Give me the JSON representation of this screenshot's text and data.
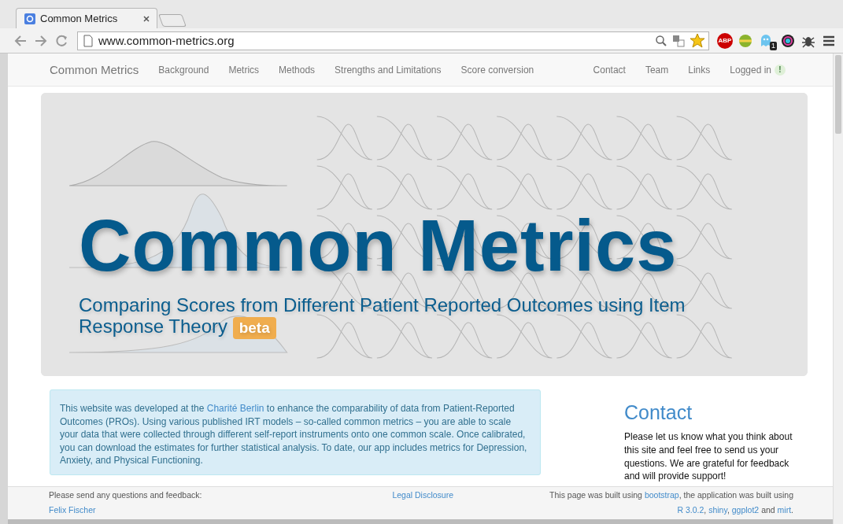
{
  "browser": {
    "tabs": [
      {
        "title": "Common Metrics",
        "selected": true
      }
    ],
    "url": "www.common-metrics.org",
    "extensions": [
      {
        "kind": "abp",
        "label": "ABP"
      },
      {
        "kind": "ball"
      },
      {
        "kind": "ghost",
        "badge": "1"
      },
      {
        "kind": "wheel"
      },
      {
        "kind": "bug"
      }
    ]
  },
  "nav": {
    "brand": "Common Metrics",
    "left": [
      {
        "label": "Background"
      },
      {
        "label": "Metrics"
      },
      {
        "label": "Methods"
      },
      {
        "label": "Strengths and Limitations"
      },
      {
        "label": "Score conversion"
      }
    ],
    "right": [
      {
        "label": "Contact"
      },
      {
        "label": "Team"
      },
      {
        "label": "Links"
      }
    ],
    "login": {
      "label": "Logged in",
      "badge": "!"
    }
  },
  "hero": {
    "kind": "picture",
    "title": "Common Metrics",
    "subtitle": "Comparing Scores from Different Patient Reported Outcomes using Item Response Theory",
    "badge": "beta"
  },
  "intro": {
    "before": "This website was developed at the ",
    "link": "Charité Berlin",
    "after": " to enhance the comparability of data from Patient-Reported Outcomes (PROs). Using various published IRT models – so-called common metrics – you are able to scale your data that were collected through different self-report instruments onto one common scale. Once calibrated, you can download the estimates for further statistical analysis. To date, our app includes metrics for Depression, Anxiety, and Physical Functioning."
  },
  "contact": {
    "heading": "Contact",
    "text": "Please let us know what you think about this site and feel free to send us your questions. We are grateful for feedback and will provide support!"
  },
  "footer": {
    "left": {
      "text": "Please send any questions and feedback:",
      "link": "Felix Fischer"
    },
    "center": {
      "link": "Legal Disclosure"
    },
    "right": [
      [
        {
          "kind": "text",
          "text": "This page was built using "
        },
        {
          "kind": "link",
          "text": "bootstrap"
        },
        {
          "kind": "text",
          "text": ", the application was built using"
        }
      ],
      [
        {
          "kind": "link",
          "text": "R 3.0.2"
        },
        {
          "kind": "text",
          "text": ", "
        },
        {
          "kind": "link",
          "text": "shiny"
        },
        {
          "kind": "text",
          "text": ", "
        },
        {
          "kind": "link",
          "text": "ggplot2"
        },
        {
          "kind": "text",
          "text": " and "
        },
        {
          "kind": "link",
          "text": "mirt"
        },
        {
          "kind": "text",
          "text": "."
        }
      ]
    ]
  }
}
